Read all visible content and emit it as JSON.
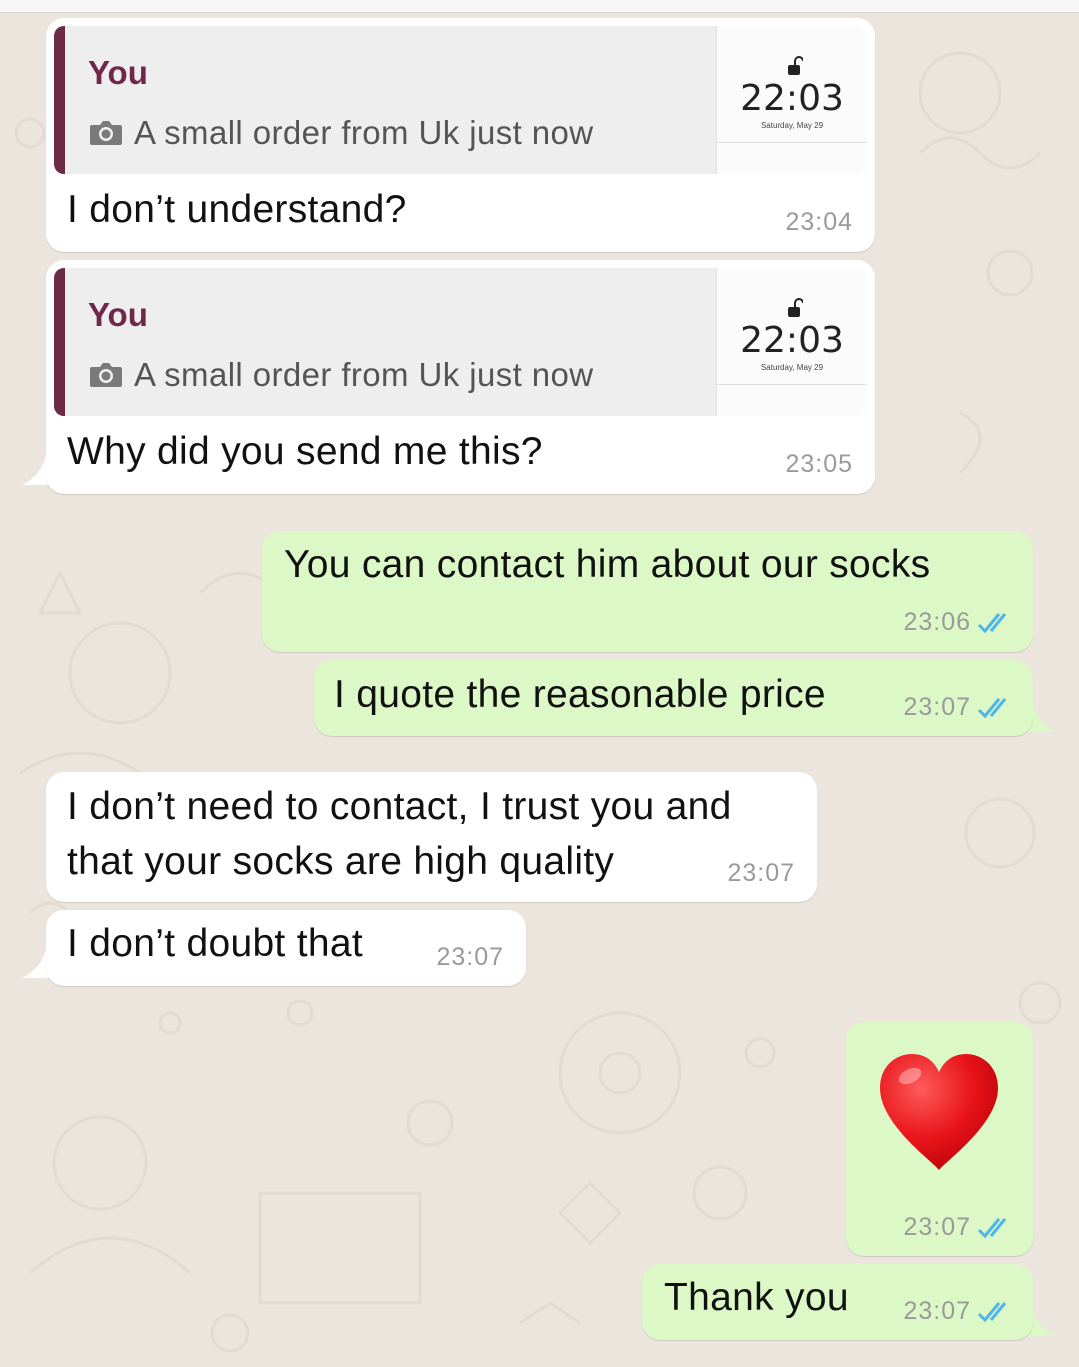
{
  "messages": [
    {
      "id": "m1",
      "direction": "incoming",
      "quote": {
        "author": "You",
        "text": "A small order from Uk just now",
        "thumb_time": "22:03",
        "thumb_date": "Saturday, May 29"
      },
      "text": "I don’t understand?",
      "time": "23:04"
    },
    {
      "id": "m2",
      "direction": "incoming",
      "quote": {
        "author": "You",
        "text": "A small order from Uk just now",
        "thumb_time": "22:03",
        "thumb_date": "Saturday, May 29"
      },
      "text": "Why did you send me this?",
      "time": "23:05"
    },
    {
      "id": "m3",
      "direction": "outgoing",
      "text": "You can contact him about our socks",
      "time": "23:06",
      "status": "read"
    },
    {
      "id": "m4",
      "direction": "outgoing",
      "text": "I quote the reasonable price",
      "time": "23:07",
      "status": "read"
    },
    {
      "id": "m5",
      "direction": "incoming",
      "text_line1": "I don’t need to contact, I trust you and",
      "text_line2": "that your socks are high quality",
      "time": "23:07"
    },
    {
      "id": "m6",
      "direction": "incoming",
      "text": "I don’t doubt that",
      "time": "23:07"
    },
    {
      "id": "m7",
      "direction": "outgoing",
      "emoji": "red-heart",
      "time": "23:07",
      "status": "read"
    },
    {
      "id": "m8",
      "direction": "outgoing",
      "text": "Thank you",
      "time": "23:07",
      "status": "read"
    }
  ],
  "colors": {
    "background": "#ece5dd",
    "incoming_bubble": "#ffffff",
    "outgoing_bubble": "#dcf8c6",
    "quote_accent": "#6b2b44",
    "read_ticks": "#4fb6ec",
    "heart": "#e8141a"
  }
}
